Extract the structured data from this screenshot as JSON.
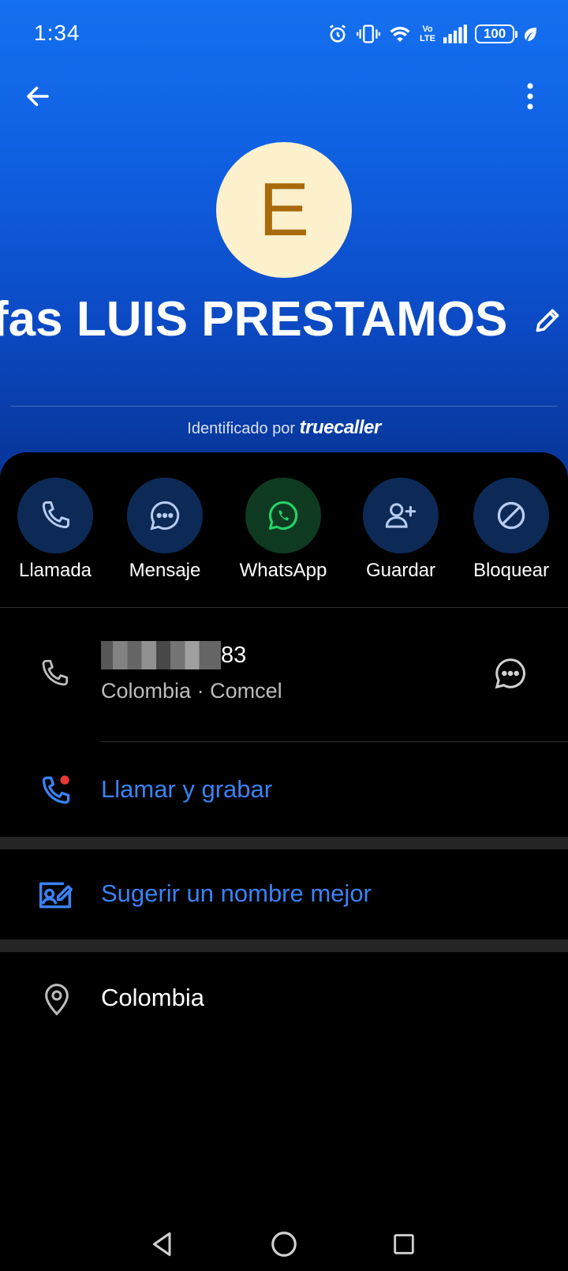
{
  "status_bar": {
    "time": "1:34",
    "battery": "100",
    "volte_top": "Vo",
    "volte_bottom": "LTE"
  },
  "header": {
    "avatar_letter": "E",
    "contact_name": "fas LUIS PRESTAMOS (",
    "identified_prefix": "Identificado por",
    "identified_brand": "truecaller"
  },
  "actions": [
    {
      "label": "Llamada",
      "icon": "phone-icon"
    },
    {
      "label": "Mensaje",
      "icon": "message-icon"
    },
    {
      "label": "WhatsApp",
      "icon": "whatsapp-icon"
    },
    {
      "label": "Guardar",
      "icon": "add-contact-icon"
    },
    {
      "label": "Bloquear",
      "icon": "block-icon"
    }
  ],
  "phone": {
    "number_suffix": "83",
    "country": "Colombia",
    "separator": "·",
    "carrier": "Comcel"
  },
  "record": {
    "label": "Llamar y grabar"
  },
  "suggest": {
    "label": "Sugerir un nombre mejor"
  },
  "location": {
    "label": "Colombia"
  },
  "colors": {
    "header_top": "#1470f0",
    "header_bottom": "#06318e",
    "link_blue": "#3b82f6",
    "action_circle": "#0d2a57",
    "whatsapp_circle": "#0f3a22",
    "whatsapp_green": "#25d366",
    "avatar_bg": "#fdf0cc",
    "avatar_fg": "#a86a0a",
    "record_dot": "#e53935"
  }
}
